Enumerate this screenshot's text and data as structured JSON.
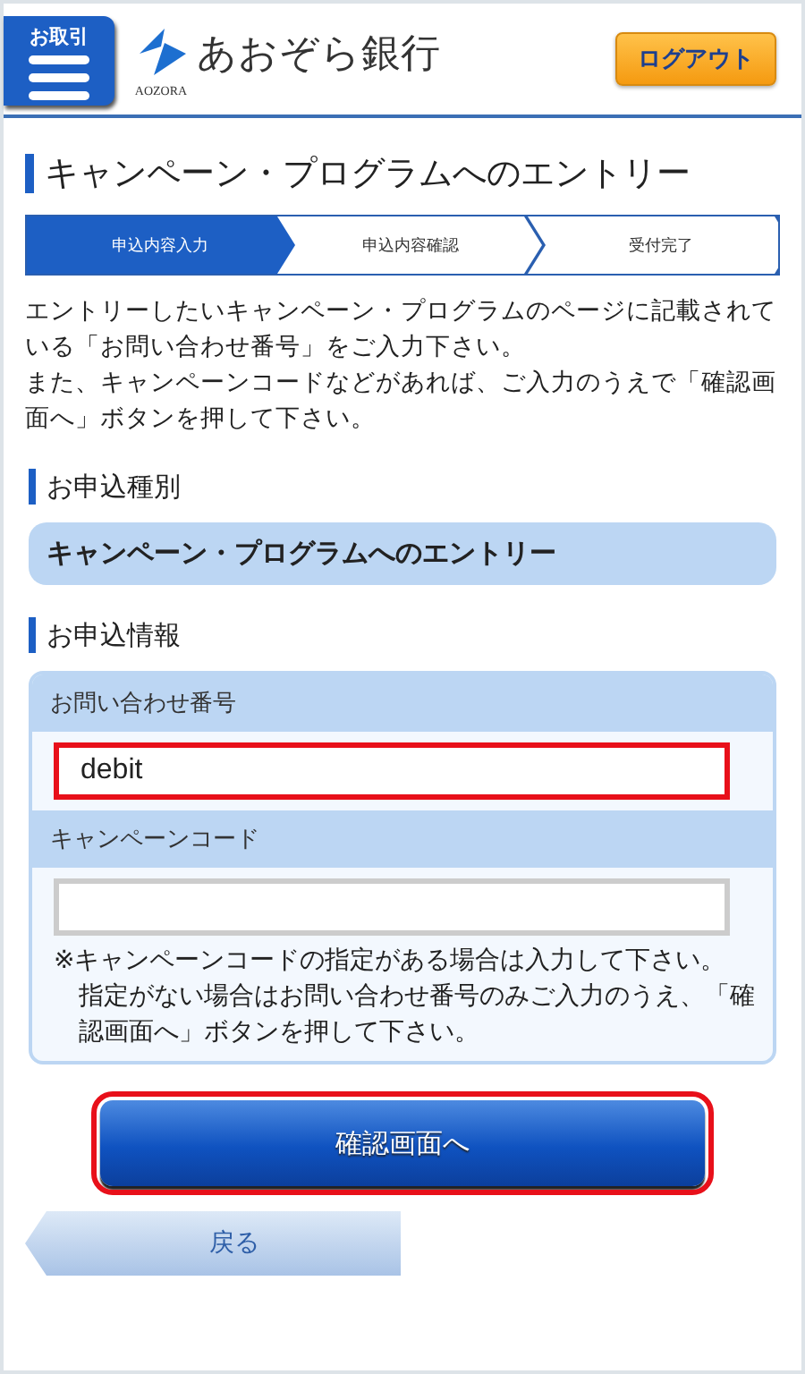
{
  "header": {
    "menu_label": "お取引",
    "bank_name": "あおぞら銀行",
    "logo_caption": "AOZORA",
    "logout": "ログアウト"
  },
  "page_title": "キャンペーン・プログラムへのエントリー",
  "steps": [
    {
      "label": "申込内容入力",
      "selected": true
    },
    {
      "label": "申込内容確認",
      "selected": false
    },
    {
      "label": "受付完了",
      "selected": false
    }
  ],
  "intro": [
    "エントリーしたいキャンペーン・プログラムのページに記載されている「お問い合わせ番号」をご入力下さい。",
    "また、キャンペーンコードなどがあれば、ご入力のうえで「確認画面へ」ボタンを押して下さい。"
  ],
  "application_type": {
    "heading": "お申込種別",
    "value": "キャンペーン・プログラムへのエントリー"
  },
  "application_info": {
    "heading": "お申込情報",
    "fields": [
      {
        "label": "お問い合わせ番号",
        "value": "debit",
        "highlighted": true
      },
      {
        "label": "キャンペーンコード",
        "highlighted": false,
        "notes": [
          "※キャンペーンコードの指定がある場合は入力して下さい。",
          "指定がない場合はお問い合わせ番号のみご入力のうえ、「確認画面へ」ボタンを押して下さい。"
        ]
      }
    ]
  },
  "confirm_button": {
    "label": "確認画面へ",
    "highlighted": true
  },
  "back_button": {
    "label": "戻る"
  }
}
